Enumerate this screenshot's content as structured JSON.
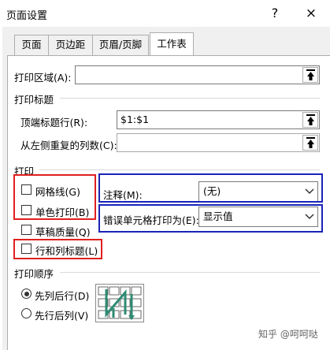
{
  "dialog": {
    "title": "页面设置",
    "help_glyph": "?",
    "close_glyph": "×"
  },
  "tabs": [
    {
      "label": "页面"
    },
    {
      "label": "页边距"
    },
    {
      "label": "页眉/页脚"
    },
    {
      "label": "工作表"
    }
  ],
  "print_area": {
    "label": "打印区域(A):",
    "value": ""
  },
  "print_titles": {
    "group_label": "打印标题",
    "rows_label": "顶端标题行(R):",
    "rows_value": "$1:$1",
    "cols_label": "从左侧重复的列数(C):",
    "cols_value": ""
  },
  "print": {
    "group_label": "打印",
    "gridlines": "网格线(G)",
    "black_white": "单色打印(B)",
    "draft": "草稿质量(Q)",
    "headings": "行和列标题(L)",
    "comments_label": "注释(M):",
    "comments_value": "(无)",
    "errors_label": "错误单元格打印为(E):",
    "errors_value": "显示值"
  },
  "page_order": {
    "group_label": "打印顺序",
    "down_then_over": "先列后行(D)",
    "over_then_down": "先行后列(V)",
    "selected": "down_then_over"
  },
  "watermark": "知乎 @呵呵哒",
  "annotation_colors": {
    "red": "#e0201f",
    "blue": "#1a23b8"
  }
}
